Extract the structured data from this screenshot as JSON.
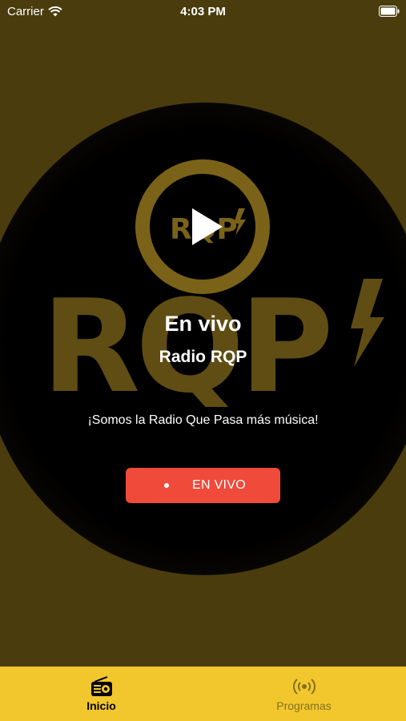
{
  "status_bar": {
    "carrier": "Carrier",
    "time": "4:03 PM",
    "wifi_icon": "wifi-icon",
    "battery_icon": "battery-icon"
  },
  "hero": {
    "logo_text": "RQP",
    "logo_color": "#7a6218",
    "title": "En vivo",
    "station_name": "Radio RQP",
    "tagline": "¡Somos la Radio Que Pasa más música!",
    "play_icon": "play-icon"
  },
  "live_button": {
    "label": "EN VIVO",
    "color": "#f04a3a"
  },
  "tab_bar": {
    "background": "#f2c72d",
    "tabs": [
      {
        "label": "Inicio",
        "icon": "radio-icon",
        "selected": true
      },
      {
        "label": "Programas",
        "icon": "broadcast-icon",
        "selected": false
      }
    ]
  }
}
